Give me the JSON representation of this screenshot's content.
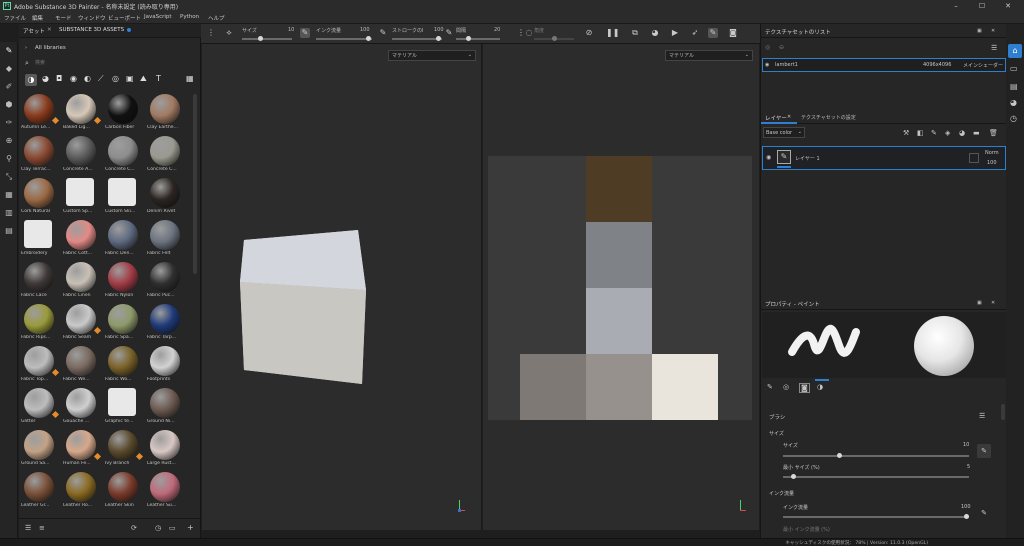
{
  "window": {
    "title": "Adobe Substance 3D Painter - 名称未設定 (読み取り専用)",
    "logo": "Pt"
  },
  "menu": [
    "ファイル",
    "編集",
    "モード",
    "ウィンドウ",
    "ビューポート",
    "JavaScript",
    "Python",
    "ヘルプ"
  ],
  "toolbar": {
    "size_label": "サイズ",
    "size_value": "10",
    "flow_label": "インク流量",
    "flow_value": "100",
    "stroke_label": "ストロークのI",
    "stroke_value": "100",
    "spacing_label": "間隔",
    "spacing_value": "20",
    "angle_label": "角度"
  },
  "assets": {
    "tab_assets": "アセット",
    "tab_substance": "SUBSTANCE 3D ASSETS",
    "all_libraries": "All libraries",
    "search_placeholder": "検索",
    "items": [
      {
        "label": "Autumn Le...",
        "color": "#8a3b1c",
        "badge": true
      },
      {
        "label": "Baked Lig...",
        "color": "#d6c8b8",
        "badge": true
      },
      {
        "label": "Carbon Fiber",
        "color": "#111111",
        "badge": false
      },
      {
        "label": "Clay Earthe...",
        "color": "#a17a62",
        "badge": false
      },
      {
        "label": "Clay Terrac...",
        "color": "#8a4a32",
        "badge": false
      },
      {
        "label": "Concrete A...",
        "color": "#5c5c5c",
        "badge": false
      },
      {
        "label": "Concrete C...",
        "color": "#8d8d8d",
        "badge": false
      },
      {
        "label": "Concrete C...",
        "color": "#9a9a90",
        "badge": false
      },
      {
        "label": "Cork Natural",
        "color": "#9b6a45",
        "badge": false
      },
      {
        "label": "Custom Sp...",
        "color": "#e8e8e8",
        "badge": false
      },
      {
        "label": "Custom Ski...",
        "color": "#e8e8e8",
        "badge": false
      },
      {
        "label": "Denim Rivet",
        "color": "#2b2521",
        "badge": false
      },
      {
        "label": "Embroidery",
        "color": "#e8e8e8",
        "badge": false
      },
      {
        "label": "Fabric Cott...",
        "color": "#e28a86",
        "badge": false
      },
      {
        "label": "Fabric Den...",
        "color": "#5e6a80",
        "badge": false
      },
      {
        "label": "Fabric Felt",
        "color": "#6c7480",
        "badge": false
      },
      {
        "label": "Fabric Lace",
        "color": "#3e3836",
        "badge": false
      },
      {
        "label": "Fabric Linen",
        "color": "#c8c0b6",
        "badge": false
      },
      {
        "label": "Fabric Nylon",
        "color": "#a23c46",
        "badge": false
      },
      {
        "label": "Fabric Puc...",
        "color": "#2f2f2f",
        "badge": false
      },
      {
        "label": "Fabric Rips...",
        "color": "#9a9a3c",
        "badge": false
      },
      {
        "label": "Fabric Seam",
        "color": "#c9c9c9",
        "badge": true
      },
      {
        "label": "Fabric Spa...",
        "color": "#8e9a6a",
        "badge": false
      },
      {
        "label": "Fabric Tarp...",
        "color": "#1f3a7a",
        "badge": false
      },
      {
        "label": "Fabric Top...",
        "color": "#bdbdbd",
        "badge": true
      },
      {
        "label": "Fabric We...",
        "color": "#7a6a60",
        "badge": false
      },
      {
        "label": "Fabric Wo...",
        "color": "#7a6228",
        "badge": false
      },
      {
        "label": "Footprints",
        "color": "#d2d2d2",
        "badge": false
      },
      {
        "label": "Glitter",
        "color": "#bdbdbd",
        "badge": true
      },
      {
        "label": "Gouache ...",
        "color": "#cfcfcf",
        "badge": false
      },
      {
        "label": "Graphic te...",
        "color": "#e8e8e8",
        "badge": false
      },
      {
        "label": "Ground Ni...",
        "color": "#6d5b52",
        "badge": false
      },
      {
        "label": "Ground Sa...",
        "color": "#c2a286",
        "badge": false
      },
      {
        "label": "Human Fe...",
        "color": "#d6a88a",
        "badge": true
      },
      {
        "label": "Ivy Branch",
        "color": "#5a4a2c",
        "badge": true
      },
      {
        "label": "Large Rust...",
        "color": "#d8c8c4",
        "badge": false
      },
      {
        "label": "Leather Gr...",
        "color": "#7a5038",
        "badge": false
      },
      {
        "label": "Leather Ro...",
        "color": "#8a6a22",
        "badge": false
      },
      {
        "label": "Leather Skin",
        "color": "#7a3a2a",
        "badge": false
      },
      {
        "label": "Leather Su...",
        "color": "#c06a7a",
        "badge": false
      }
    ]
  },
  "viewport3d": {
    "dropdown": "マテリアル"
  },
  "viewport2d": {
    "dropdown": "マテリアル"
  },
  "textureset_list": {
    "title": "テクスチャセットのリスト",
    "row_name": "lambert1",
    "row_res": "4096x4096",
    "row_shader": "メインシェーダー"
  },
  "layers": {
    "tab_layers": "レイヤー",
    "tab_settings": "テクスチャセットの設定",
    "channel": "Base color",
    "layer_name": "レイヤー 1",
    "blend": "Norm",
    "opacity": "100"
  },
  "properties": {
    "title": "プロパティ - ペイント",
    "brush_section": "ブラシ",
    "size_group": "サイズ",
    "size_label": "サイズ",
    "size_value": "10",
    "min_size_label": "最小 サイズ (%)",
    "min_size_value": "5",
    "flow_group": "インク流量",
    "flow_label": "インク流量",
    "flow_value": "100",
    "min_flow_label": "最小 インク流量 (%)"
  },
  "status": {
    "text": "キャッシュディスクの使用状況：  78% | Version: 11.0.3 (OpenGL)"
  },
  "colors": {
    "accent": "#2f7fd1",
    "bg": "#262626"
  }
}
